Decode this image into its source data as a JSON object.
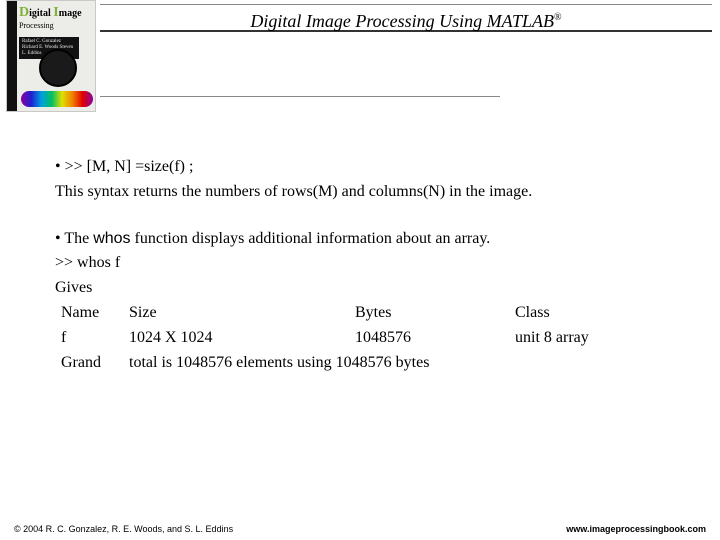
{
  "header": {
    "title_main": "Digital Image Processing Using MATLAB",
    "title_reg": "®"
  },
  "thumb": {
    "line1_big": "D",
    "line1_rest": "igital",
    "line2_big": "I",
    "line2_rest": "mage",
    "sub": "Processing",
    "authors": "Rafael C. Gonzalez\nRichard E. Woods\nSteven L. Eddins"
  },
  "body": {
    "bullet1_prefix": "•   ",
    "bullet1_code": ">> [M, N] =size(f) ;",
    "line2": "This syntax returns the numbers of rows(M) and columns(N) in the image.",
    "bullet2_prefix": "•   The ",
    "bullet2_whos": "whos",
    "bullet2_rest": " function displays additional information about an array.",
    "code2": " >>  whos f",
    "gives": "Gives",
    "hdr_name": " Name",
    "hdr_size": "Size",
    "hdr_bytes": " Bytes",
    "hdr_class": " Class",
    "row_name": "  f",
    "row_size": "1024 X 1024",
    "row_bytes": "1048576",
    "row_class": " unit 8 array",
    "grand_label": "Grand",
    "grand_rest": "total is 1048576 elements using 1048576 bytes"
  },
  "footer": {
    "left": "© 2004 R. C. Gonzalez, R. E. Woods, and S. L. Eddins",
    "right": "www.imageprocessingbook.com"
  }
}
